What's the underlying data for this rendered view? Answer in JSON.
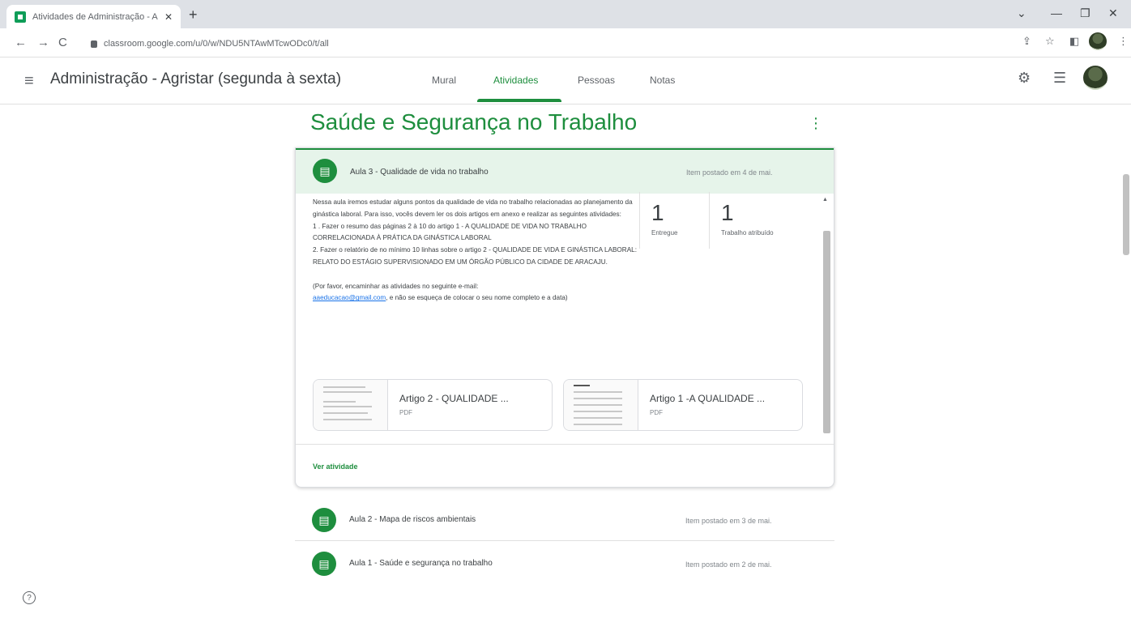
{
  "browser": {
    "tab_title": "Atividades de Administração - A",
    "tab_close": "✕",
    "new_tab": "+",
    "url": "classroom.google.com/u/0/w/NDU5NTAwMTcwODc0/t/all",
    "back": "←",
    "forward": "→",
    "reload": "C",
    "minimize": "—",
    "restore": "❐",
    "close": "✕",
    "share_icon": "⇪",
    "star_icon": "☆",
    "sidepanel_icon": "◧",
    "menu_icon": "⋮",
    "chevron": "⌄"
  },
  "header": {
    "class_title": "Administração - Agristar (segunda à sexta)",
    "tabs": [
      {
        "label": "Mural",
        "active": false
      },
      {
        "label": "Atividades",
        "active": true
      },
      {
        "label": "Pessoas",
        "active": false
      },
      {
        "label": "Notas",
        "active": false
      }
    ],
    "settings_icon": "⚙",
    "apps_icon": "☰",
    "accent": "#1e8e3e"
  },
  "topic": {
    "title": "Saúde e Segurança no Trabalho",
    "menu": "⋮"
  },
  "expanded": {
    "title": "Aula 3 - Qualidade de vida no trabalho",
    "posted": "Item postado em 4 de mai.",
    "description": [
      "Nessa aula iremos estudar alguns pontos da qualidade de vida no trabalho relacionadas ao planejamento da ginástica laboral. Para isso, vocês devem ler os dois artigos em anexo e realizar as seguintes atividades:",
      "1 . Fazer o resumo das páginas 2 à 10 do artigo 1 - A QUALIDADE DE VIDA NO TRABALHO CORRELACIONADA À PRÁTICA DA GINÁSTICA LABORAL",
      "2. Fazer o relatório de no mínimo 10 linhas sobre o artigo 2 - QUALIDADE DE VIDA E GINÁSTICA LABORAL: RELATO DO ESTÁGIO SUPERVISIONADO EM UM ÓRGÃO PÚBLICO DA CIDADE DE ARACAJU.",
      "",
      "(Por favor, encaminhar as atividades no seguinte e-mail:"
    ],
    "email": "aaeducacao@gmail.com",
    "desc_tail": ", e não se esqueça de colocar o seu nome completo e a data)",
    "stats": [
      {
        "num": "1",
        "label": "Entregue"
      },
      {
        "num": "1",
        "label": "Trabalho atribuído"
      }
    ],
    "attachments": [
      {
        "name": "Artigo 2 - QUALIDADE ...",
        "type": "PDF"
      },
      {
        "name": "Artigo 1 -A QUALIDADE ...",
        "type": "PDF"
      }
    ],
    "view_link": "Ver atividade"
  },
  "items": [
    {
      "title": "Aula 2 - Mapa de riscos ambientais",
      "posted": "Item postado em 3 de mai."
    },
    {
      "title": "Aula 1 - Saúde e segurança no trabalho",
      "posted": "Item postado em 2 de mai."
    }
  ],
  "help": "?"
}
